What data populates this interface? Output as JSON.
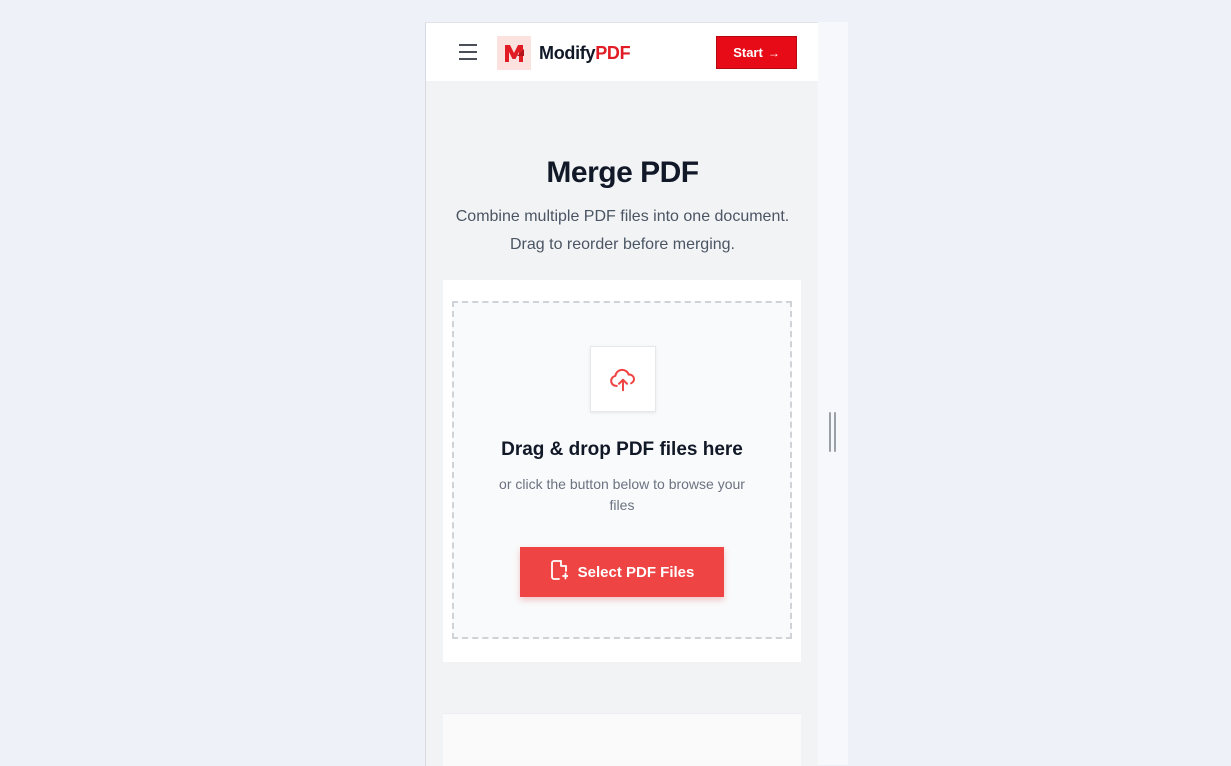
{
  "header": {
    "menu_icon": "hamburger-icon",
    "brand_name": "Modify",
    "brand_accent": "PDF",
    "start_label": "Start",
    "start_icon": "arrow-right-icon"
  },
  "page": {
    "title": "Merge PDF",
    "subtitle": "Combine multiple PDF files into one document. Drag to reorder before merging."
  },
  "dropzone": {
    "icon": "cloud-upload-icon",
    "title": "Drag & drop PDF files here",
    "subtitle": "or click the button below to browse your files",
    "button_label": "Select PDF Files",
    "button_icon": "file-plus-icon"
  },
  "colors": {
    "accent": "#e60b17",
    "button": "#ef4444",
    "text_dark": "#111827",
    "text_muted": "#6b7280",
    "background": "#eef1f8"
  }
}
